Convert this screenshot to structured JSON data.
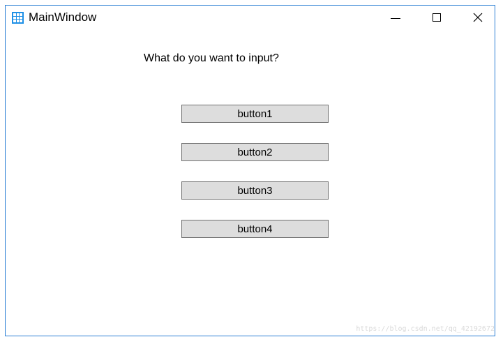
{
  "window": {
    "title": "MainWindow",
    "icon": "app-grid-icon",
    "accent_color": "#1e90e6",
    "border_color": "#2b7fd4"
  },
  "controls": {
    "minimize_icon": "minimize-icon",
    "maximize_icon": "maximize-icon",
    "close_icon": "close-icon",
    "close_glyph": "✕"
  },
  "main": {
    "prompt": "What do you want to input?",
    "buttons": [
      "button1",
      "button2",
      "button3",
      "button4"
    ]
  },
  "watermark": "https://blog.csdn.net/qq_42192672"
}
